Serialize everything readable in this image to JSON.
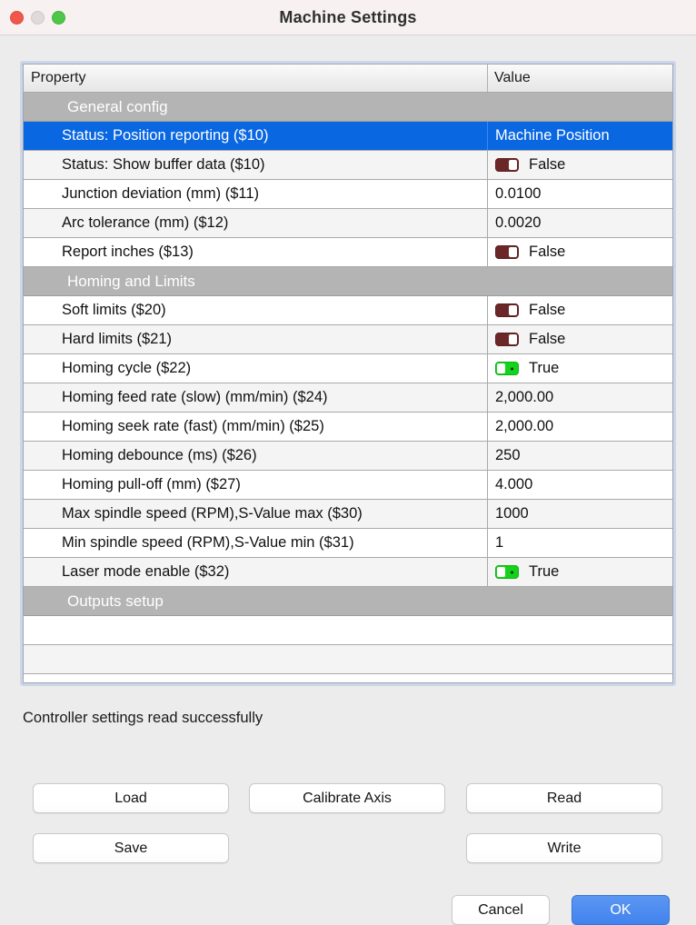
{
  "window": {
    "title": "Machine Settings",
    "traffic": {
      "close": "close-button",
      "minimize": "minimize-button",
      "zoom": "zoom-button"
    }
  },
  "table": {
    "columns": [
      "Property",
      "Value"
    ],
    "rows": [
      {
        "type": "group",
        "property": "General config",
        "value": ""
      },
      {
        "type": "text",
        "property": "Status: Position reporting ($10)",
        "value": "Machine Position",
        "selected": true
      },
      {
        "type": "toggle",
        "property": "Status: Show buffer data ($10)",
        "value": "False",
        "state": false
      },
      {
        "type": "text",
        "property": "Junction deviation (mm) ($11)",
        "value": "0.0100"
      },
      {
        "type": "text",
        "property": "Arc tolerance (mm) ($12)",
        "value": "0.0020"
      },
      {
        "type": "toggle",
        "property": "Report inches ($13)",
        "value": "False",
        "state": false
      },
      {
        "type": "group",
        "property": "Homing and Limits",
        "value": ""
      },
      {
        "type": "toggle",
        "property": "Soft limits ($20)",
        "value": "False",
        "state": false
      },
      {
        "type": "toggle",
        "property": "Hard limits ($21)",
        "value": "False",
        "state": false
      },
      {
        "type": "toggle",
        "property": "Homing cycle ($22)",
        "value": "True",
        "state": true
      },
      {
        "type": "text",
        "property": "Homing feed rate (slow) (mm/min) ($24)",
        "value": "2,000.00"
      },
      {
        "type": "text",
        "property": "Homing seek rate (fast) (mm/min) ($25)",
        "value": "2,000.00"
      },
      {
        "type": "text",
        "property": "Homing debounce (ms) ($26)",
        "value": "250"
      },
      {
        "type": "text",
        "property": "Homing pull-off (mm) ($27)",
        "value": "4.000"
      },
      {
        "type": "text",
        "property": "Max spindle speed (RPM),S-Value max ($30)",
        "value": "1000"
      },
      {
        "type": "text",
        "property": "Min spindle speed (RPM),S-Value min ($31)",
        "value": "1"
      },
      {
        "type": "toggle",
        "property": "Laser mode enable ($32)",
        "value": "True",
        "state": true
      },
      {
        "type": "group",
        "property": "Outputs setup",
        "value": ""
      },
      {
        "type": "empty",
        "property": "",
        "value": ""
      },
      {
        "type": "empty",
        "property": "",
        "value": ""
      }
    ]
  },
  "status": {
    "message": "Controller settings read successfully"
  },
  "buttons": {
    "load": "Load",
    "calibrate_axis": "Calibrate Axis",
    "read": "Read",
    "save": "Save",
    "write": "Write",
    "cancel": "Cancel",
    "ok": "OK"
  },
  "colors": {
    "selection_blue": "#0a67e2",
    "ok_blue": "#4183ee",
    "group_grey": "#b4b4b4",
    "toggle_on_green": "#15d31b",
    "toggle_off_maroon": "#6b2727",
    "titlebar": "#f8f1f1",
    "window_bg": "#ececec"
  }
}
